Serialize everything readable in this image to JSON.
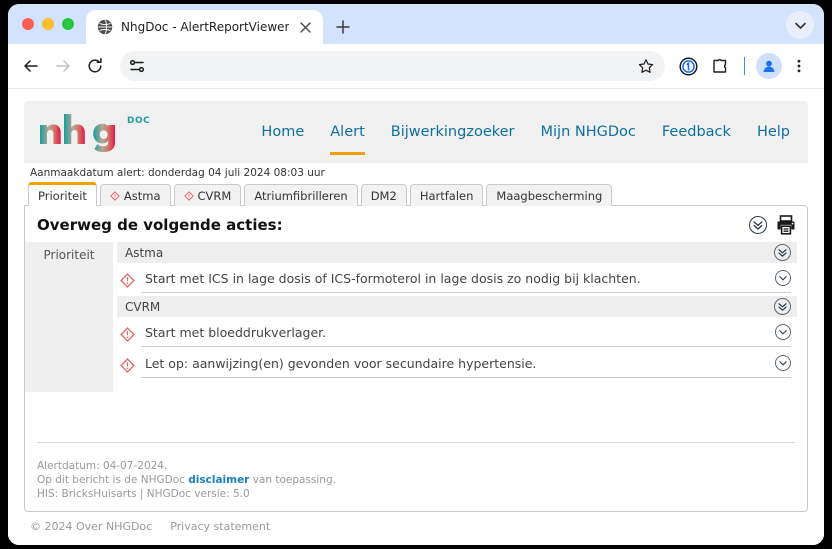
{
  "browser": {
    "tab": {
      "title": "NhgDoc - AlertReportViewer",
      "favicon_name": "globe-icon",
      "close_label": "×"
    },
    "new_tab_label": "+",
    "tab_list_chevron": "chevron-down-icon",
    "toolbar": {
      "back_label": "←",
      "forward_label": "→",
      "reload_label": "↻",
      "address_value": "",
      "address_placeholder": "",
      "tune_icon": "tune-icon",
      "bookmark_icon": "star-icon",
      "password_icon": "onepassword-icon",
      "extensions_icon": "extensions-puzzle-icon",
      "profile_icon": "profile-avatar-icon",
      "menu_icon": "three-dot-menu-icon"
    }
  },
  "site": {
    "logo": {
      "text": "nhg",
      "suffix": "DOC"
    },
    "nav": [
      {
        "label": "Home",
        "active": false
      },
      {
        "label": "Alert",
        "active": true
      },
      {
        "label": "Bijwerkingzoeker",
        "active": false
      },
      {
        "label": "Mijn NHGDoc",
        "active": false
      },
      {
        "label": "Feedback",
        "active": false
      },
      {
        "label": "Help",
        "active": false
      }
    ],
    "aanmaakdatum": "Aanmaakdatum alert: donderdag 04 juli 2024 08:03 uur",
    "tabs": [
      {
        "label": "Prioriteit",
        "active": true,
        "alert": false
      },
      {
        "label": "Astma",
        "active": false,
        "alert": true
      },
      {
        "label": "CVRM",
        "active": false,
        "alert": true
      },
      {
        "label": "Atriumfibrilleren",
        "active": false,
        "alert": false
      },
      {
        "label": "DM2",
        "active": false,
        "alert": false
      },
      {
        "label": "Hartfalen",
        "active": false,
        "alert": false
      },
      {
        "label": "Maagbescherming",
        "active": false,
        "alert": false
      }
    ],
    "panel": {
      "title": "Overweg de volgende acties:",
      "expand_all_icon": "double-chevron-down-icon",
      "print_icon": "printer-icon",
      "priority_column_label": "Prioriteit",
      "groups": [
        {
          "name": "Astma",
          "actions": [
            {
              "text": "Start met ICS in lage dosis of ICS-formoterol in lage dosis zo nodig bij klachten."
            }
          ]
        },
        {
          "name": "CVRM",
          "actions": [
            {
              "text": "Start met bloeddrukverlager."
            },
            {
              "text": "Let op: aanwijzing(en) gevonden voor secundaire hypertensie."
            }
          ]
        }
      ],
      "footer": {
        "line1": "Alertdatum: 04-07-2024.",
        "line2_before": "Op dit bericht is de NHGDoc ",
        "line2_link": "disclaimer",
        "line2_after": " van toepassing.",
        "line3": "HIS: BricksHuisarts | NHGDoc versie: 5.0"
      }
    },
    "page_footer": {
      "copyright": "© 2024 Over NHGDoc",
      "privacy": "Privacy statement"
    }
  },
  "colors": {
    "accent_orange": "#f0a000",
    "nav_blue": "#0f6f9e",
    "logo_teal": "#1a9c9c",
    "logo_tan": "#b5a898",
    "logo_crimson": "#e0174f",
    "alert_red": "#e8635f",
    "link_blue": "#1a7fc1"
  }
}
